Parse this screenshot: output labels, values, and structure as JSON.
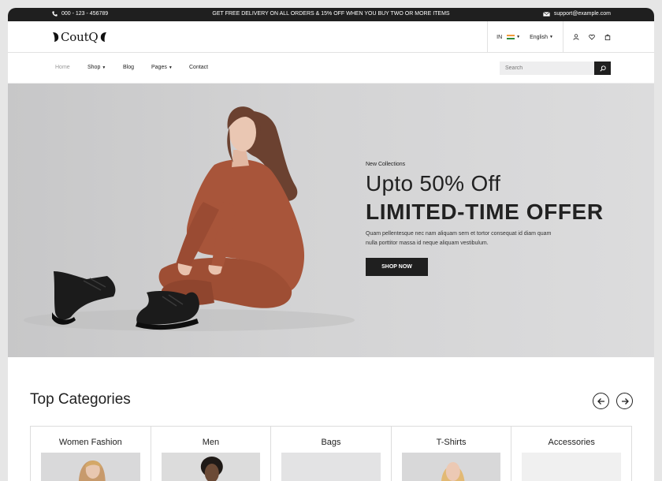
{
  "topbar": {
    "phone": "000 - 123 - 456789",
    "promo": "GET FREE DELIVERY ON ALL ORDERS & 15% OFF WHEN YOU BUY TWO OR MORE ITEMS",
    "email": "support@example.com",
    "icons": [
      "phone-icon",
      "mail-icon"
    ]
  },
  "header": {
    "logo": "CoutQ",
    "country": "IN",
    "language": "English",
    "icons": [
      "user-icon",
      "heart-icon",
      "bag-icon"
    ]
  },
  "nav": {
    "items": [
      "Home",
      "Shop",
      "Blog",
      "Pages",
      "Contact"
    ],
    "active": "Home",
    "search_placeholder": "Search"
  },
  "hero": {
    "eyebrow": "New Collections",
    "subtitle": "Upto 50% Off",
    "title": "LIMITED-TIME OFFER",
    "description": "Quam pellentesque nec nam aliquam sem et tortor consequat id diam quam nulla porttitor massa id neque aliquam vestibulum.",
    "button": "SHOP NOW"
  },
  "categories": {
    "title": "Top Categories",
    "items": [
      "Women Fashion",
      "Men",
      "Bags",
      "T-Shirts",
      "Accessories"
    ]
  },
  "colors": {
    "dark": "#1f1f1f",
    "hero_bg": "#d3d3d4",
    "jacket": "#a8553a"
  }
}
